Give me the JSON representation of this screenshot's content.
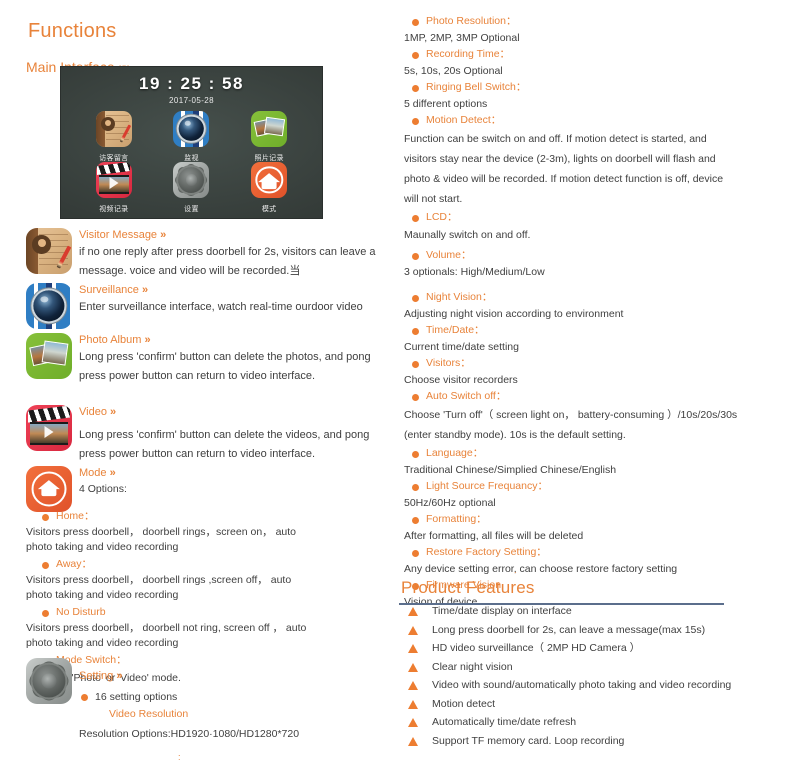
{
  "sections": {
    "functions_title": "Functions",
    "main_interface_label": "Main Interface",
    "chevrons": "≫≫",
    "product_features_title": "Product Features"
  },
  "colors": {
    "accent_orange": "#E8833A",
    "bullet_orange": "#ED7D31",
    "rule_slate": "#5B6E8C",
    "body_text": "#404040"
  },
  "device_screen": {
    "time": "19 : 25 : 58",
    "date": "2017-05-28",
    "apps": [
      {
        "icon": "visitor-message-icon",
        "label": "访客留言"
      },
      {
        "icon": "surveillance-icon",
        "label": "监视"
      },
      {
        "icon": "photo-album-icon",
        "label": "照片记录"
      },
      {
        "icon": "video-icon",
        "label": "视频记录"
      },
      {
        "icon": "setting-icon",
        "label": "设置"
      },
      {
        "icon": "mode-icon",
        "label": "模式"
      }
    ]
  },
  "features": [
    {
      "icon": "visitor-message-icon",
      "title": "Visitor Message",
      "lines": [
        "if no one reply after press doorbell for 2s, visitors can leave a",
        "message. voice and video will be recorded.当"
      ]
    },
    {
      "icon": "surveillance-icon",
      "title": "Surveillance",
      "lines": [
        "Enter surveillance interface, watch real-time ourdoor video"
      ]
    },
    {
      "icon": "photo-album-icon",
      "title": "Photo Album",
      "lines": [
        "Long press 'confirm' button can delete the photos, and pong",
        "press power button can return to video interface."
      ]
    },
    {
      "icon": "video-icon",
      "title": "Video",
      "lines": [
        "Long press 'confirm' button can delete the videos, and pong",
        "press power button can return to video interface."
      ]
    }
  ],
  "mode_section": {
    "icon": "mode-icon",
    "title": "Mode",
    "intro": "4 Options:",
    "options": [
      {
        "head": "Home：",
        "lines": [
          "Visitors press doorbell， doorbell rings，screen on， auto",
          "photo taking and video recording"
        ]
      },
      {
        "head": "Away：",
        "lines": [
          "Visitors press doorbell， doorbell rings ,screen off， auto",
          "photo taking and video recording"
        ]
      },
      {
        "head": "No Disturb",
        "lines": [
          "Visitors press doorbell， doorbell not ring, screen off ， auto",
          "photo taking and video recording"
        ]
      },
      {
        "head": "Mode Switch：",
        "lines": [
          " Switch to 'Photo' or 'Video' mode."
        ]
      }
    ]
  },
  "setting_section": {
    "icon": "setting-icon",
    "title": "Setting",
    "count_label": "16 setting options",
    "sub_label": "Video Resolution",
    "resolution_text": "Resolution Options:HD1920·1080/HD1280*720"
  },
  "settings_right": [
    {
      "head": "Photo Resolution：",
      "body": [
        "1MP, 2MP, 3MP Optional"
      ]
    },
    {
      "head": "Recording Time：",
      "body": [
        "5s, 10s, 20s Optional"
      ]
    },
    {
      "head": "Ringing Bell Switch：",
      "body": [
        "5 different options"
      ]
    },
    {
      "head": "Motion Detect：",
      "body": [
        "Function can be switch on and off. If motion detect is started, and",
        "visitors stay near the device (2-3m), lights on doorbell will flash and",
        "photo & video will be recorded.   If motion detect function is off, device",
        "will not start."
      ],
      "wide": true
    },
    {
      "head": "LCD：",
      "body": [
        " Maunally switch on and off."
      ]
    },
    {
      "head": "Volume：",
      "body": [
        "3 optionals: High/Medium/Low"
      ]
    },
    {
      "head": "Night Vision：",
      "body": [
        "Adjusting night vision according to environment"
      ]
    },
    {
      "head": "Time/Date：",
      "body": [
        "Current time/date setting"
      ]
    },
    {
      "head": "Visitors：",
      "body": [
        "Choose visitor recorders"
      ]
    },
    {
      "head": "Auto Switch off：",
      "body": [
        "Choose 'Turn off'（ screen light on， battery-consuming ）/10s/20s/30s",
        "(enter standby mode). 10s is the default setting."
      ],
      "wide": true
    },
    {
      "head": "Language：",
      "body": [
        "Traditional Chinese/Simplied Chinese/English"
      ]
    },
    {
      "head": "Light Source Frequancy：",
      "body": [
        "50Hz/60Hz optional"
      ]
    },
    {
      "head": "Formatting：",
      "body": [
        "After formatting, all files will be deleted"
      ]
    },
    {
      "head": "Restore Factory Setting：",
      "body": [
        "Any device setting error, can choose restore factory setting"
      ]
    },
    {
      "head": "Firmware Vision",
      "body": [
        " Vision of device"
      ]
    }
  ],
  "product_features": [
    "Time/date display on interface",
    "Long press doorbell for 2s, can leave a message(max 15s)",
    "HD video surveillance（ 2MP HD Camera ）",
    "Clear night vision",
    "Video with sound/automatically photo taking and video recording",
    "Motion detect",
    "Automatically time/date refresh",
    "Support TF memory card. Loop recording"
  ]
}
